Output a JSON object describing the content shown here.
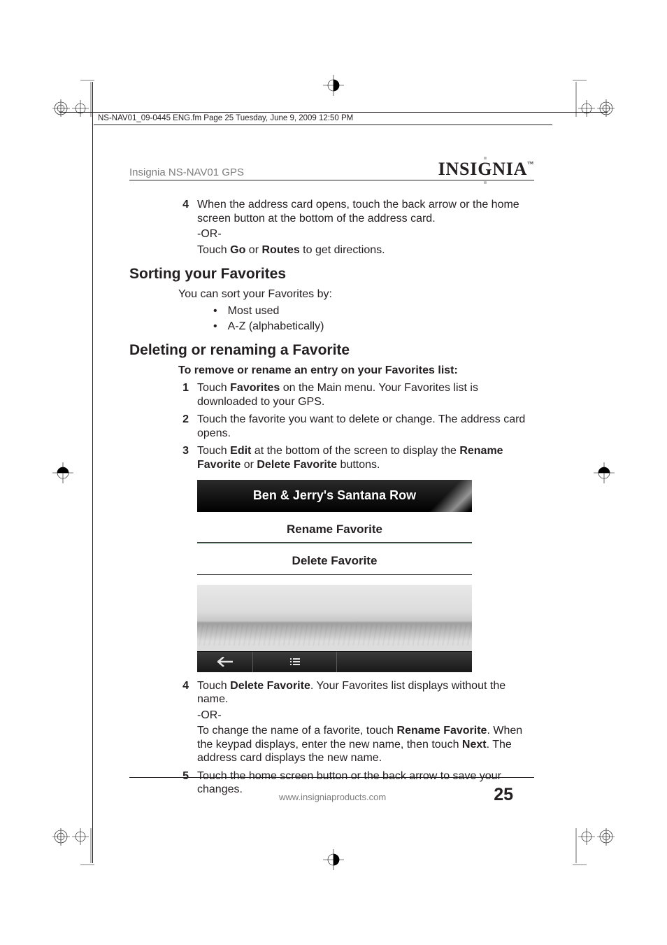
{
  "header_note": "NS-NAV01_09-0445 ENG.fm  Page 25  Tuesday, June 9, 2009  12:50 PM",
  "running_title": "Insignia NS-NAV01 GPS",
  "brand_logo": "INSIGNIA",
  "trademark": "™",
  "step4a": {
    "num": "4",
    "line1": "When the address card opens, touch the back arrow or the home screen button at the bottom of the address card.",
    "or": "-OR-",
    "line2_pre": "Touch ",
    "line2_b1": "Go",
    "line2_mid": " or ",
    "line2_b2": "Routes",
    "line2_post": " to get directions."
  },
  "section_sort": {
    "title": "Sorting your Favorites",
    "intro": "You can sort your Favorites by:",
    "bullets": [
      "Most used",
      "A-Z (alphabetically)"
    ]
  },
  "section_delete": {
    "title": "Deleting or renaming a Favorite",
    "intro": "To remove or rename an entry on your Favorites list:",
    "steps": {
      "s1": {
        "num": "1",
        "pre": "Touch ",
        "b1": "Favorites",
        "post": " on the Main menu. Your Favorites list is downloaded to your GPS."
      },
      "s2": {
        "num": "2",
        "text": "Touch the favorite you want to delete or change. The address card opens."
      },
      "s3": {
        "num": "3",
        "pre": "Touch ",
        "b1": "Edit",
        "mid": " at the bottom of the screen to display the ",
        "b2": "Rename Favorite",
        "mid2": " or ",
        "b3": "Delete Favorite",
        "post": " buttons."
      },
      "s4": {
        "num": "4",
        "pre": "Touch ",
        "b1": "Delete Favorite",
        "post": ". Your Favorites list displays without the name.",
        "or": "-OR-",
        "p2_pre": "To change the name of a favorite, touch ",
        "p2_b1": "Rename Favorite",
        "p2_mid": ". When the keypad displays, enter the new name, then touch ",
        "p2_b2": "Next",
        "p2_post": ". The address card displays the new name."
      },
      "s5": {
        "num": "5",
        "text": "Touch the home screen button or the back arrow to save your changes."
      }
    }
  },
  "gps_screenshot": {
    "location": "Ben & Jerry's Santana Row",
    "option1": "Rename Favorite",
    "option2": "Delete Favorite"
  },
  "footer": {
    "url": "www.insigniaproducts.com",
    "page": "25"
  }
}
